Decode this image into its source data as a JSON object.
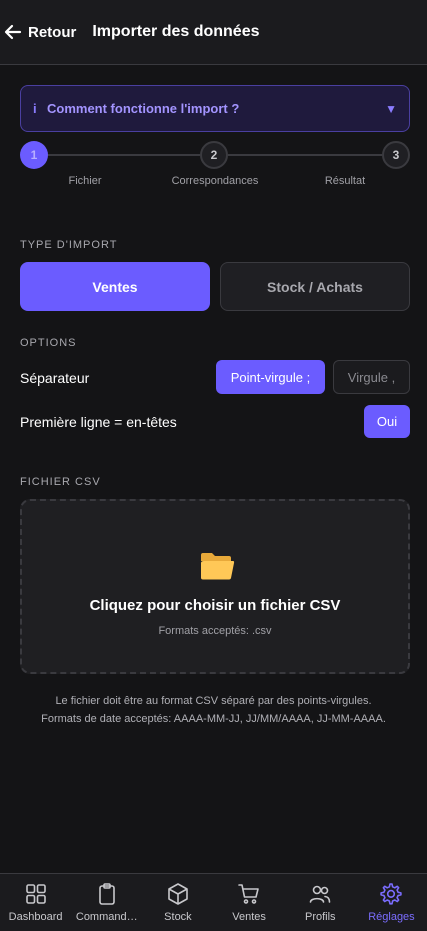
{
  "header": {
    "back_label": "Retour",
    "title": "Importer des données"
  },
  "howto": {
    "label": "Comment fonctionne l'import ?",
    "info_glyph": "i",
    "caret_glyph": "▼"
  },
  "steps": [
    {
      "number": "1",
      "label": "Fichier",
      "active": true
    },
    {
      "number": "2",
      "label": "Correspondances",
      "active": false
    },
    {
      "number": "3",
      "label": "Résultat",
      "active": false
    }
  ],
  "import_type": {
    "section_label": "TYPE D'IMPORT",
    "options": [
      "Ventes",
      "Stock / Achats"
    ],
    "selected": "Ventes"
  },
  "options": {
    "section_label": "OPTIONS",
    "separator_label": "Séparateur",
    "separator_options": [
      "Point-virgule  ;",
      "Virgule  ,"
    ],
    "separator_selected": "Point-virgule  ;",
    "header_label": "Première ligne = en-têtes",
    "header_value": "Oui"
  },
  "csv": {
    "section_label": "FICHIER CSV",
    "drop_title": "Cliquez pour choisir un fichier CSV",
    "drop_sub": "Formats acceptés: .csv",
    "icon": "folder-icon"
  },
  "note": {
    "line1": "Le fichier doit être au format CSV séparé par des points-virgules.",
    "line2": "Formats de date acceptés: AAAA-MM-JJ, JJ/MM/AAAA, JJ-MM-AAAA."
  },
  "tabs": [
    {
      "label": "Dashboard",
      "icon": "grid-icon"
    },
    {
      "label": "Command…",
      "icon": "clipboard-icon"
    },
    {
      "label": "Stock",
      "icon": "box-icon"
    },
    {
      "label": "Ventes",
      "icon": "cart-icon"
    },
    {
      "label": "Profils",
      "icon": "users-icon"
    },
    {
      "label": "Réglages",
      "icon": "gear-icon",
      "active": true
    }
  ],
  "colors": {
    "accent": "#6b5cff",
    "background": "#141416",
    "surface": "#1b1b1e",
    "border": "#3a3a3f"
  }
}
